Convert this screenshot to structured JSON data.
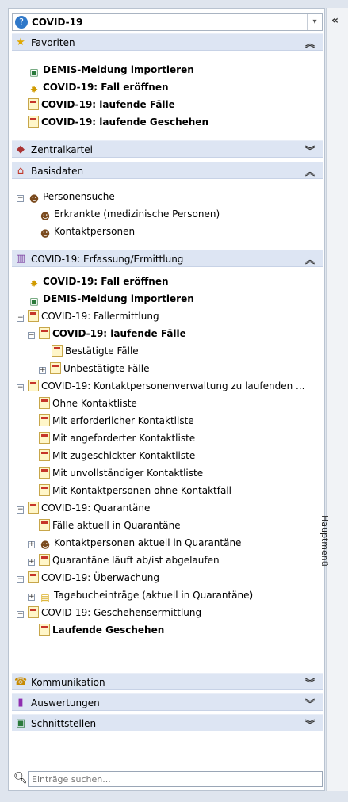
{
  "header": {
    "selected_module": "COVID-19",
    "collapse_label": "«",
    "side_label": "Hauptmenü"
  },
  "sections": {
    "favoriten": "Favoriten",
    "zentralkartei": "Zentralkartei",
    "basisdaten": "Basisdaten",
    "erfassung": "COVID-19: Erfassung/Ermittlung",
    "kommunikation": "Kommunikation",
    "auswertungen": "Auswertungen",
    "schnittstellen": "Schnittstellen"
  },
  "favoriten_items": [
    "DEMIS-Meldung importieren",
    "COVID-19: Fall eröffnen",
    "COVID-19: laufende Fälle",
    "COVID-19: laufende Geschehen"
  ],
  "basisdaten_items": [
    "Personensuche",
    "Erkrankte (medizinische Personen)",
    "Kontaktpersonen"
  ],
  "erfassung_items": [
    "COVID-19: Fall eröffnen",
    "DEMIS-Meldung importieren",
    "COVID-19: Fallermittlung",
    "COVID-19: laufende Fälle",
    "Bestätigte Fälle",
    "Unbestätigte Fälle",
    "COVID-19: Kontaktpersonenverwaltung zu laufenden ...",
    "Ohne Kontaktliste",
    "Mit erforderlicher Kontaktliste",
    "Mit angeforderter Kontaktliste",
    "Mit zugeschickter Kontaktliste",
    "Mit unvollständiger Kontaktliste",
    "Mit Kontaktpersonen ohne Kontaktfall",
    "COVID-19: Quarantäne",
    "Fälle aktuell in Quarantäne",
    "Kontaktpersonen aktuell in Quarantäne",
    "Quarantäne läuft ab/ist abgelaufen",
    "COVID-19: Überwachung",
    "Tagebucheinträge (aktuell in Quarantäne)",
    "COVID-19: Geschehensermittlung",
    "Laufende Geschehen"
  ],
  "search": {
    "placeholder": "Einträge suchen..."
  }
}
